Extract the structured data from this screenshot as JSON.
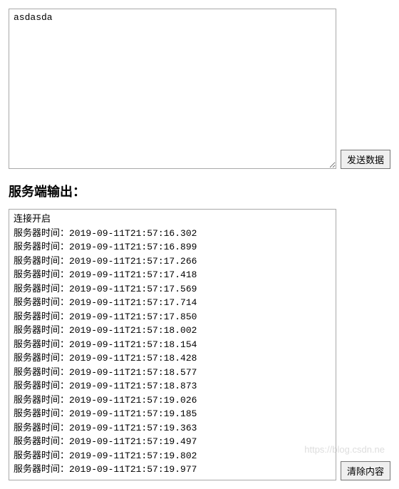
{
  "input": {
    "value": "asdasda"
  },
  "buttons": {
    "send": "发送数据",
    "clear": "清除内容"
  },
  "heading": "服务端输出：",
  "output": {
    "connection_line": "连接开启",
    "server_time_prefix": "服务器时间：",
    "timestamps": [
      "2019-09-11T21:57:16.302",
      "2019-09-11T21:57:16.899",
      "2019-09-11T21:57:17.266",
      "2019-09-11T21:57:17.418",
      "2019-09-11T21:57:17.569",
      "2019-09-11T21:57:17.714",
      "2019-09-11T21:57:17.850",
      "2019-09-11T21:57:18.002",
      "2019-09-11T21:57:18.154",
      "2019-09-11T21:57:18.428",
      "2019-09-11T21:57:18.577",
      "2019-09-11T21:57:18.873",
      "2019-09-11T21:57:19.026",
      "2019-09-11T21:57:19.185",
      "2019-09-11T21:57:19.363",
      "2019-09-11T21:57:19.497",
      "2019-09-11T21:57:19.802",
      "2019-09-11T21:57:19.977"
    ]
  },
  "watermark": "https://blog.csdn.ne"
}
